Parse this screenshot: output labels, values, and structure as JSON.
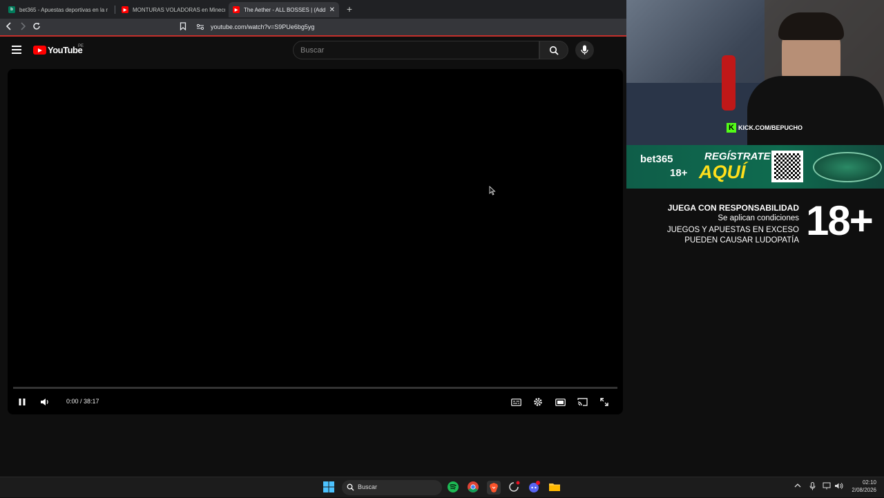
{
  "browser": {
    "tabs": [
      {
        "title": "bet365 - Apuestas deportivas en la r",
        "favicon_color": "#027b5b",
        "active": false
      },
      {
        "title": "MONTURAS VOLADORAS en Minecr",
        "favicon_color": "#ff0000",
        "active": false
      },
      {
        "title": "The Aether - ALL BOSSES | (Add",
        "favicon_color": "#ff0000",
        "active": true
      }
    ],
    "new_tab": "+",
    "close_tab": "✕",
    "url": "youtube.com/watch?v=S9PUe6bg5yg"
  },
  "youtube": {
    "logo_text": "YouTube",
    "country_code": "PE",
    "search_placeholder": "Buscar"
  },
  "player": {
    "time_display": "0:00 / 38:17",
    "progress": 0
  },
  "stream_overlay": {
    "channel": "KICK.COM/BEPUCHO",
    "sponsor_name": "bet365",
    "sponsor_age": "18+",
    "sponsor_cta_top": "REGÍSTRATE",
    "sponsor_cta_bottom": "AQUÍ",
    "responsibility_title": "JUEGA CON RESPONSABILIDAD",
    "responsibility_sub": "Se aplican condiciones",
    "warning_line1": "JUEGOS Y APUESTAS EN EXCESO",
    "warning_line2": "PUEDEN CAUSAR LUDOPATÍA",
    "age_badge": "18+"
  },
  "taskbar": {
    "search_label": "Buscar",
    "time": "02:10",
    "date": "2/08/2026"
  },
  "colors": {
    "yt_red": "#ff0000",
    "kick_green": "#53fc18",
    "bet365_green": "#0f6b4f",
    "bet365_yellow": "#ffdf1b"
  }
}
